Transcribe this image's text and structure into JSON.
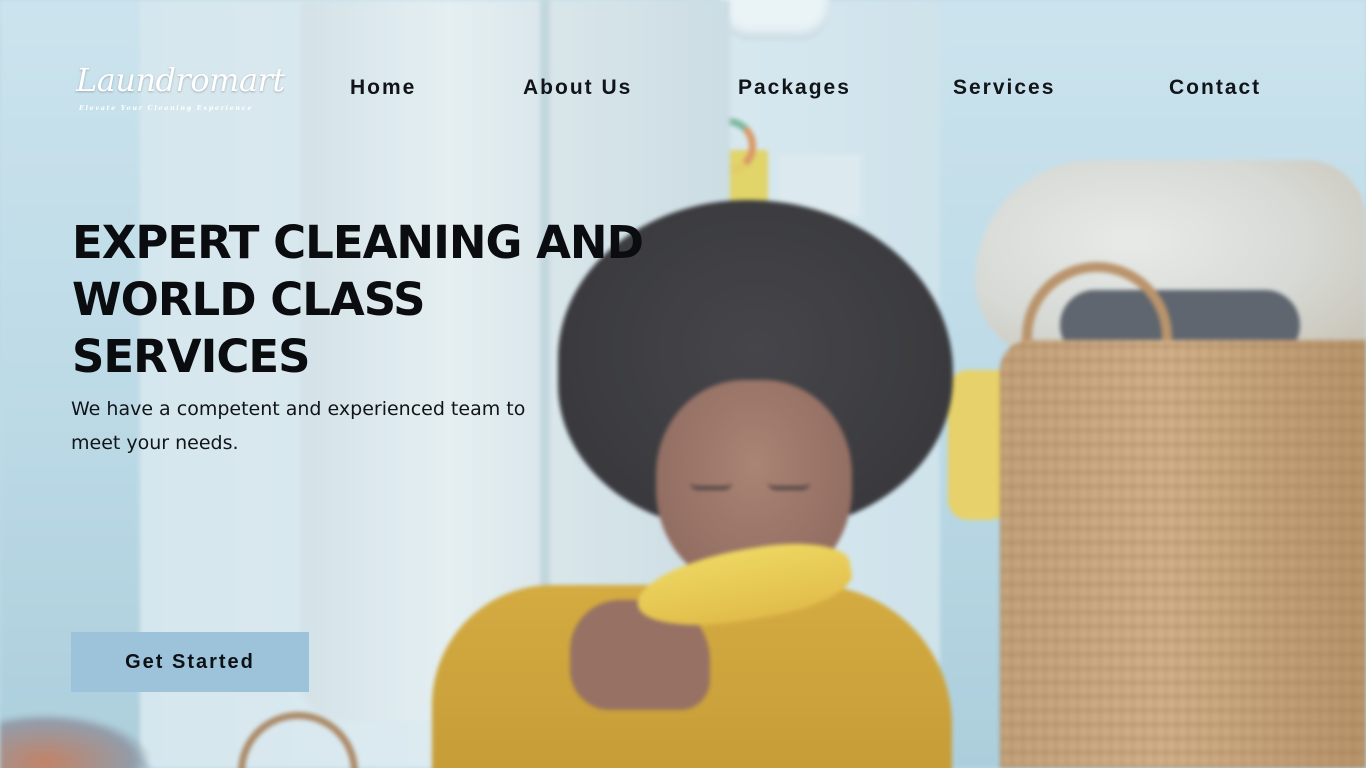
{
  "brand": {
    "logo_text": "Laundromart",
    "tagline": "Elevate Your Cleaning Experience"
  },
  "nav": {
    "items": [
      {
        "label": "Home"
      },
      {
        "label": "About Us"
      },
      {
        "label": "Packages"
      },
      {
        "label": "Services"
      },
      {
        "label": "Contact"
      }
    ]
  },
  "hero": {
    "title_lines": [
      "EXPERT CLEANING AND",
      "WORLD CLASS",
      "SERVICES"
    ],
    "subtitle_lines": [
      "We have a competent and experienced team to",
      "meet your needs."
    ],
    "cta_label": "Get Started",
    "background_image": "child-eating-banana-in-laundry-room"
  },
  "colors": {
    "cta_background": "#9cc3d9",
    "text_dark": "#0a0c0f",
    "logo": "#ffffff"
  }
}
